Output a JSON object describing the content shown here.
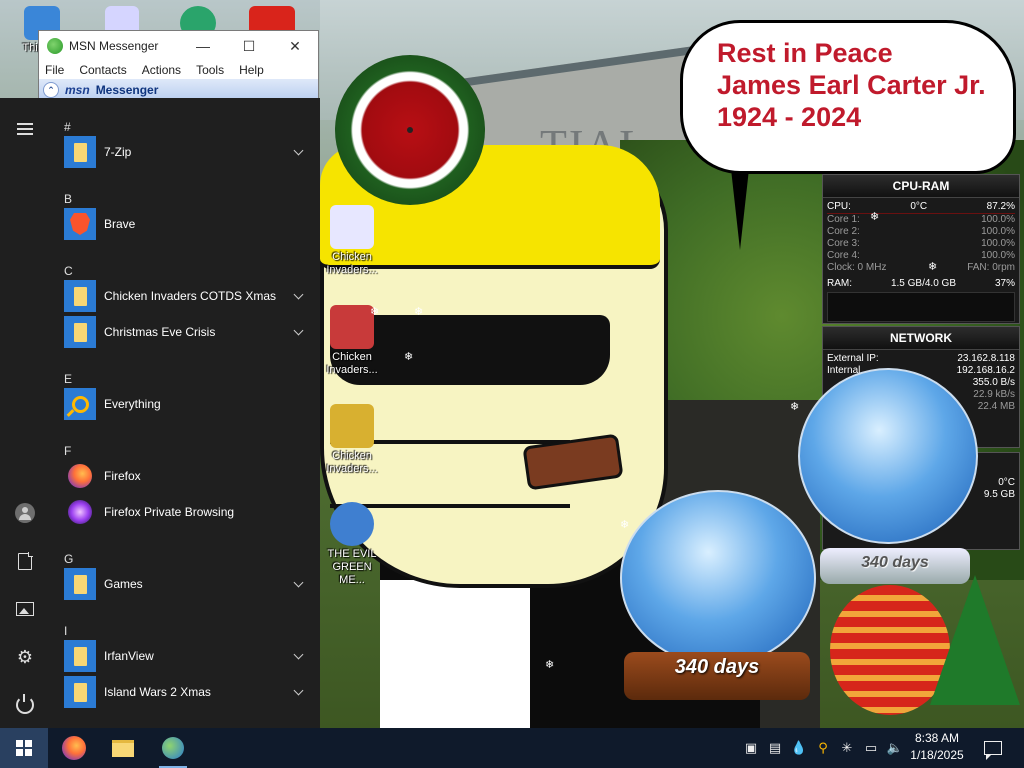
{
  "msn_window": {
    "title": "MSN Messenger",
    "menu": [
      "File",
      "Contacts",
      "Actions",
      "Tools",
      "Help"
    ],
    "banner_logo": "msn",
    "banner_text": "Messenger",
    "icons": [
      "msn-butterfly-icon",
      "minimize-icon",
      "maximize-icon",
      "close-icon"
    ]
  },
  "start_menu": {
    "rail": [
      "hamburger-menu-icon",
      "user-icon",
      "documents-icon",
      "pictures-icon",
      "settings-icon",
      "power-icon"
    ],
    "groups": [
      {
        "letter": "#",
        "items": [
          {
            "label": "7-Zip",
            "icon": "folder-icon",
            "expandable": true
          }
        ]
      },
      {
        "letter": "B",
        "items": [
          {
            "label": "Brave",
            "icon": "brave-icon",
            "expandable": false
          }
        ]
      },
      {
        "letter": "C",
        "items": [
          {
            "label": "Chicken Invaders COTDS Xmas",
            "icon": "folder-icon",
            "expandable": true
          },
          {
            "label": "Christmas Eve Crisis",
            "icon": "folder-icon",
            "expandable": true
          }
        ]
      },
      {
        "letter": "E",
        "items": [
          {
            "label": "Everything",
            "icon": "everything-search-icon",
            "expandable": false
          }
        ]
      },
      {
        "letter": "F",
        "items": [
          {
            "label": "Firefox",
            "icon": "firefox-icon",
            "expandable": false
          },
          {
            "label": "Firefox Private Browsing",
            "icon": "firefox-private-icon",
            "expandable": false
          }
        ]
      },
      {
        "letter": "G",
        "items": [
          {
            "label": "Games",
            "icon": "folder-icon",
            "expandable": true
          }
        ]
      },
      {
        "letter": "I",
        "items": [
          {
            "label": "IrfanView",
            "icon": "folder-icon",
            "expandable": true
          },
          {
            "label": "Island Wars 2 Xmas",
            "icon": "folder-icon",
            "expandable": true
          }
        ]
      }
    ]
  },
  "desktop": {
    "top_icons": [
      "This PC",
      "",
      "",
      ""
    ],
    "icons": [
      {
        "label": "Chicken Invaders...",
        "color": "#e7e7ff"
      },
      {
        "label": "Chicken Invaders...",
        "color": "#c83a3a"
      },
      {
        "label": "Chicken Invaders...",
        "color": "#d8b030"
      },
      {
        "label": "THE EVIL GREEN ME...",
        "color": "#3f7fd0"
      }
    ],
    "speech_bubble": [
      "Rest in Peace",
      "James Earl Carter Jr.",
      "1924 - 2024"
    ],
    "snowglobe_days": "340 days",
    "snowglobe2_days": "340 days",
    "background_text": "TIAL"
  },
  "cpu_ram_gadget": {
    "title": "CPU-RAM",
    "cpu_label": "CPU:",
    "cpu_temp": "0°C",
    "cpu_pct": "87.2%",
    "cores": [
      {
        "label": "Core 1:",
        "value": "100.0%"
      },
      {
        "label": "Core 2:",
        "value": "100.0%"
      },
      {
        "label": "Core 3:",
        "value": "100.0%"
      },
      {
        "label": "Core 4:",
        "value": "100.0%"
      }
    ],
    "clock": "Clock: 0 MHz",
    "fan": "FAN: 0rpm",
    "ram_label": "RAM:",
    "ram_used": "1.5 GB/4.0 GB",
    "ram_pct": "37%"
  },
  "network_gadget": {
    "title": "NETWORK",
    "external_label": "External IP:",
    "external_ip": "23.162.8.118",
    "internal_label": "Internal",
    "internal_ip": "192.168.16.2",
    "rate1": "355.0 B/s",
    "rate2": "22.9 kB/s",
    "rate3": "22.4 MB"
  },
  "third_gadget": {
    "temp": "0°C",
    "size": "9.5 GB"
  },
  "taskbar": {
    "apps": [
      "windows-start-icon",
      "firefox-icon",
      "file-explorer-icon",
      "msn-messenger-icon"
    ],
    "tray_icons": [
      "tray-app-icon",
      "tray-network-app-icon",
      "droplet-icon",
      "search-tray-icon",
      "snowflake-icon",
      "network-icon",
      "volume-icon"
    ],
    "time": "8:38 AM",
    "date": "1/18/2025"
  },
  "colors": {
    "start_menu_bg": "#1f1f1f",
    "tile_blue": "#2b7bd4",
    "speech_red": "#c01a2c",
    "taskbar": "#0f1a2b"
  }
}
